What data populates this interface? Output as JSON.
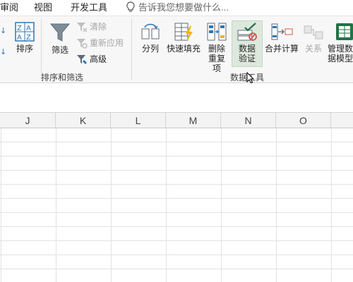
{
  "menubar": {
    "tabs": [
      "审阅",
      "视图",
      "开发工具"
    ],
    "search_placeholder": "告诉我您想要做什么..."
  },
  "ribbon": {
    "sort_filter_group": {
      "label": "排序和筛选",
      "sort_label": "排序",
      "filter_label": "筛选",
      "clear_label": "清除",
      "reapply_label": "重新应用",
      "advanced_label": "高级"
    },
    "data_tools_group": {
      "label": "数据工具",
      "text_to_columns_label": "分列",
      "flash_fill_label": "快速填充",
      "remove_duplicates_label": "删除重复项",
      "data_validation_label": "数据验证",
      "consolidate_label": "合并计算",
      "relationships_label": "关系",
      "manage_data_model_label": "管理数据模型"
    }
  },
  "grid": {
    "columns": [
      "J",
      "K",
      "L",
      "M",
      "N",
      "O"
    ]
  },
  "colors": {
    "ribbon_bg": "#f7f7f7",
    "highlight": "#dde8dd",
    "accent_blue": "#2e75b6",
    "accent_green": "#217346"
  }
}
